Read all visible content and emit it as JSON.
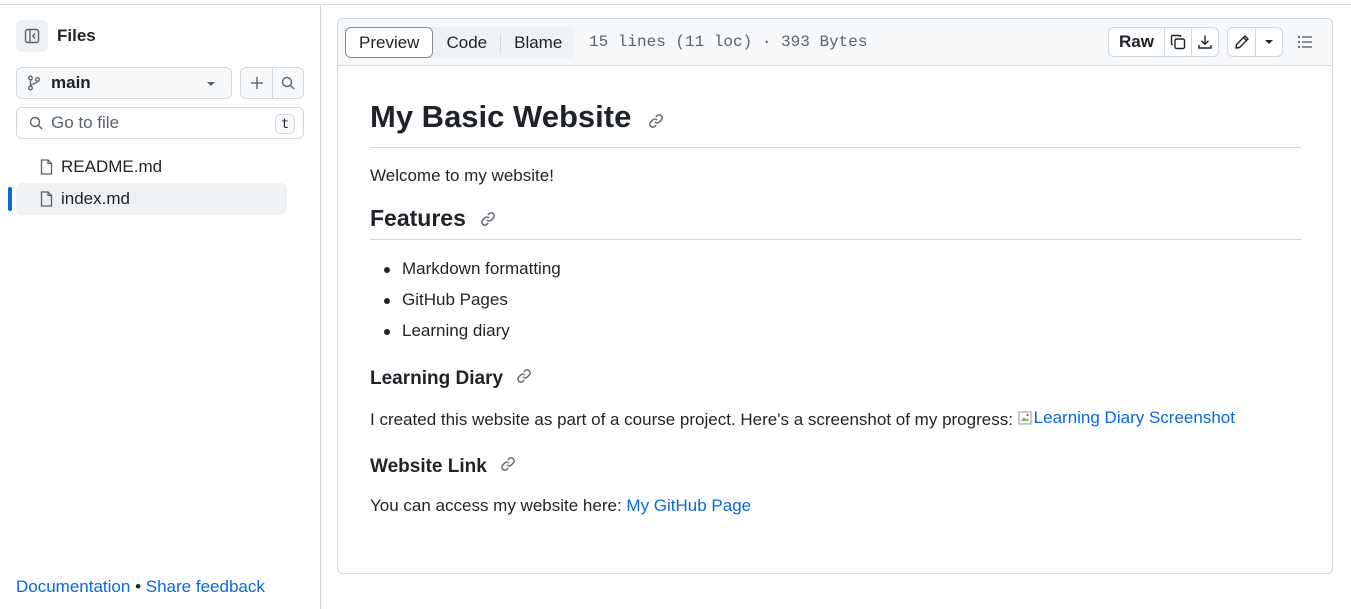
{
  "sidebar": {
    "title": "Files",
    "branch": "main",
    "search_placeholder": "Go to file",
    "search_shortcut": "t",
    "files": [
      {
        "name": "README.md",
        "active": false
      },
      {
        "name": "index.md",
        "active": true
      }
    ],
    "footer": {
      "documentation": "Documentation",
      "separator": "•",
      "feedback": "Share feedback"
    }
  },
  "file_header": {
    "tabs": [
      "Preview",
      "Code",
      "Blame"
    ],
    "selected_tab": "Preview",
    "info": "15 lines (11 loc) · 393 Bytes",
    "raw_label": "Raw"
  },
  "markdown": {
    "h1": "My Basic Website",
    "intro": "Welcome to my website!",
    "features_heading": "Features",
    "features": [
      "Markdown formatting",
      "GitHub Pages",
      "Learning diary"
    ],
    "diary_heading": "Learning Diary",
    "diary_text": "I created this website as part of a course project. Here's a screenshot of my progress:",
    "diary_image_alt": "Learning Diary Screenshot",
    "link_heading": "Website Link",
    "link_text": "You can access my website here:",
    "link_label": "My GitHub Page"
  },
  "colors": {
    "accent": "#0969da",
    "border": "#d1d9e0",
    "muted": "#59636e"
  }
}
